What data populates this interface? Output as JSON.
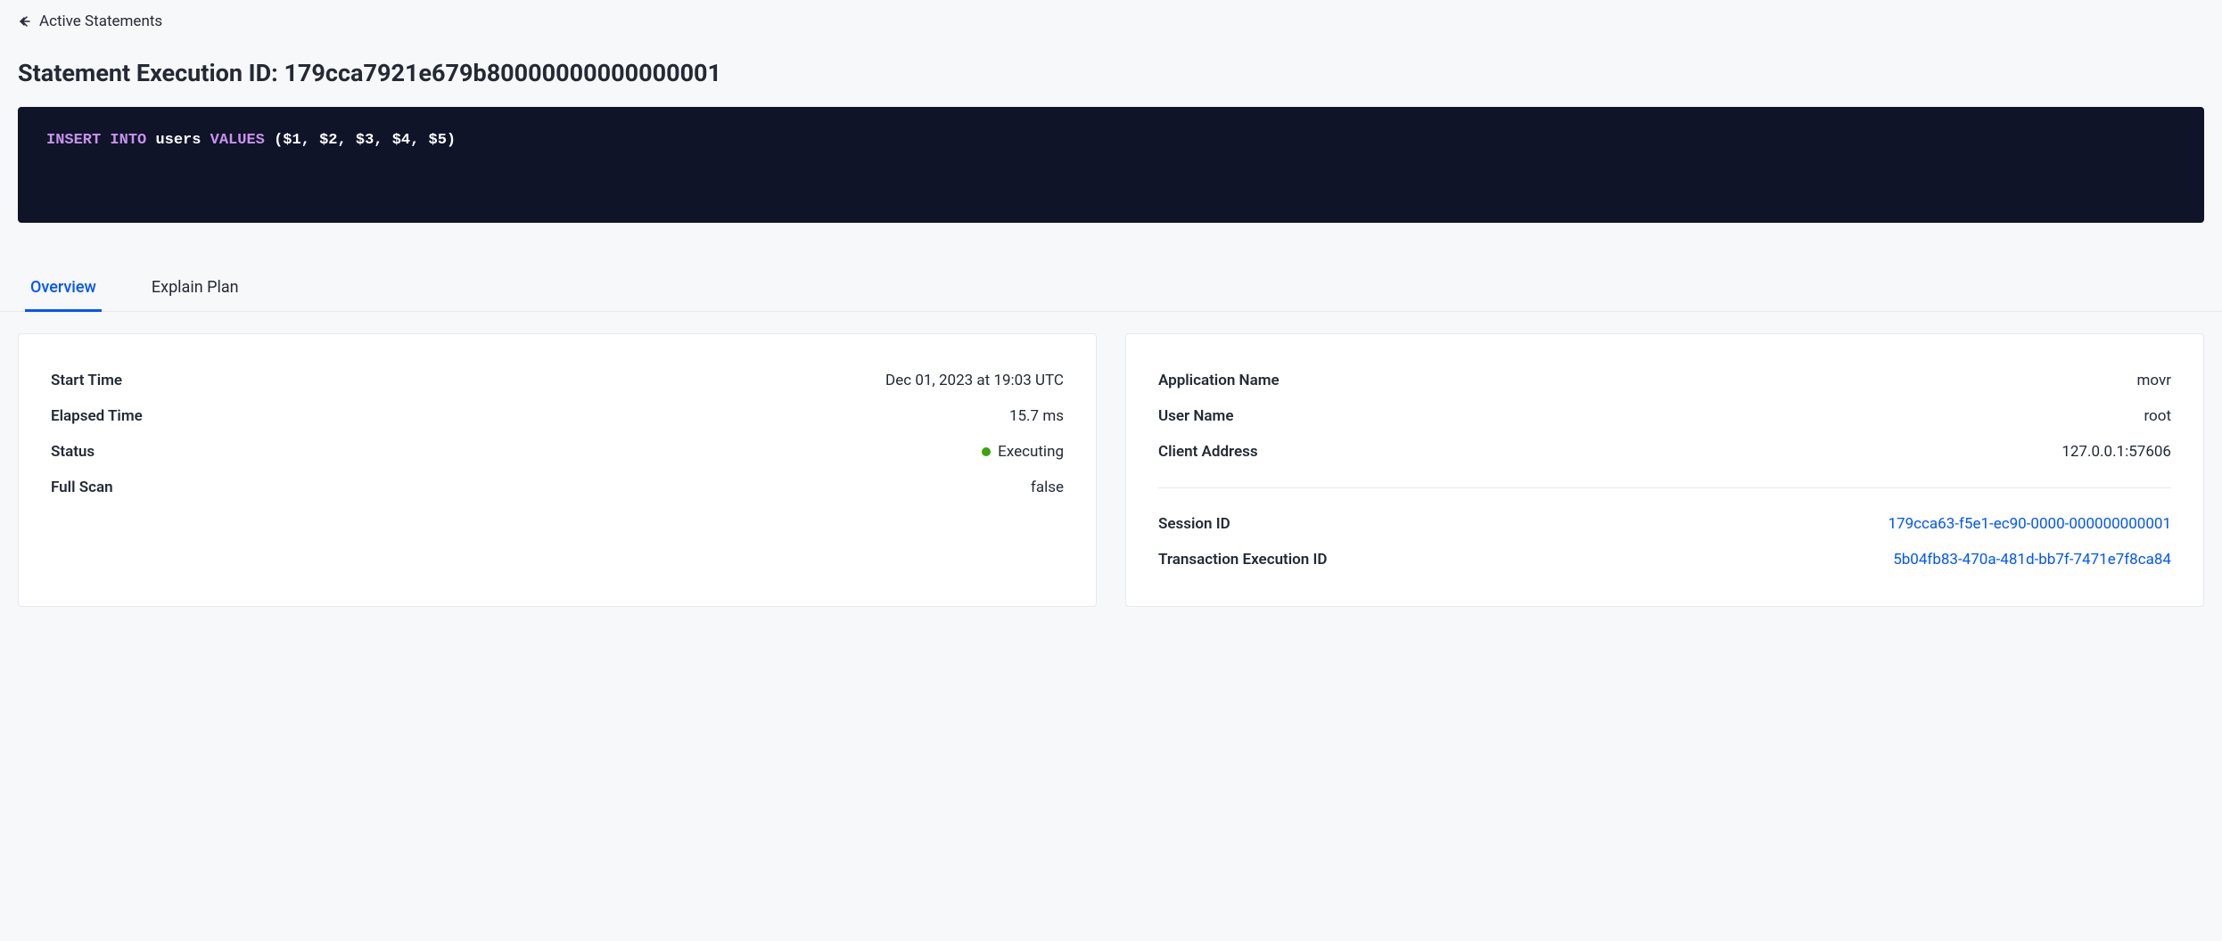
{
  "breadcrumb": {
    "back_label": "Active Statements"
  },
  "page_title_prefix": "Statement Execution ID: ",
  "execution_id": "179cca7921e679b80000000000000001",
  "sql": {
    "keyword1": "INSERT",
    "keyword2": "INTO",
    "ident": "users",
    "keyword3": "VALUES",
    "args": "($1, $2, $3, $4, $5)"
  },
  "tabs": {
    "overview": "Overview",
    "explain_plan": "Explain Plan"
  },
  "left_card": {
    "start_time_label": "Start Time",
    "start_time_value": "Dec 01, 2023 at 19:03 UTC",
    "elapsed_time_label": "Elapsed Time",
    "elapsed_time_value": "15.7 ms",
    "status_label": "Status",
    "status_value": "Executing",
    "status_color": "#37a806",
    "full_scan_label": "Full Scan",
    "full_scan_value": "false"
  },
  "right_card": {
    "app_name_label": "Application Name",
    "app_name_value": "movr",
    "user_name_label": "User Name",
    "user_name_value": "root",
    "client_address_label": "Client Address",
    "client_address_value": "127.0.0.1:57606",
    "session_id_label": "Session ID",
    "session_id_value": "179cca63-f5e1-ec90-0000-000000000001",
    "txn_exec_id_label": "Transaction Execution ID",
    "txn_exec_id_value": "5b04fb83-470a-481d-bb7f-7471e7f8ca84"
  }
}
